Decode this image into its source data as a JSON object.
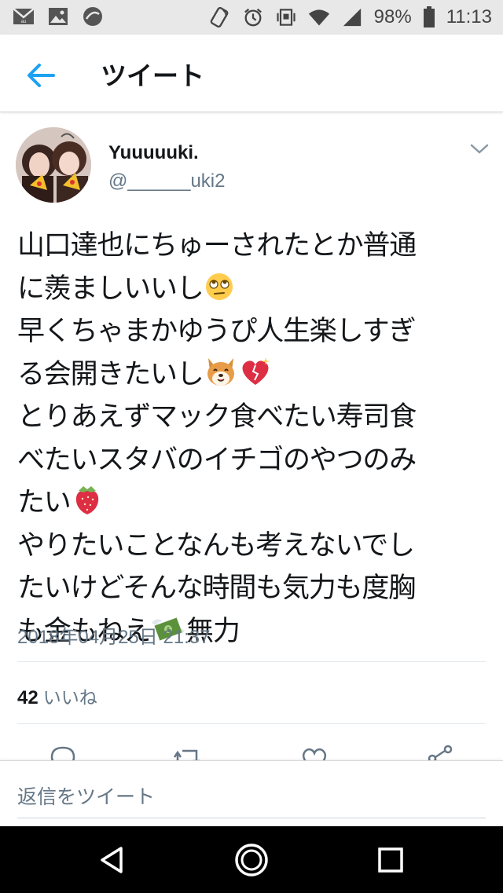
{
  "status_bar": {
    "battery": "98%",
    "time": "11:13",
    "icons": [
      "mail-icon",
      "image-icon",
      "app-icon",
      "nfc-icon",
      "alarm-icon",
      "vibrate-icon",
      "wifi-icon",
      "signal-icon",
      "battery-icon"
    ]
  },
  "app_bar": {
    "title": "ツイート",
    "back_icon": "back-arrow-icon"
  },
  "tweet": {
    "display_name": "Yuuuuuki.",
    "handle": "@______uki2",
    "lines": [
      "山口達也にちゅーされたとか普通",
      "に羨ましいいし",
      "早くちゃまかゆうぴ人生楽しすぎ",
      "る会開きたいし",
      "とりあえずマック食べたい寿司食",
      "べたいスタバのイチゴのやつのみ",
      "たい",
      "やりたいことなんも考えないでし",
      "たいけどそんな時間も気力も度胸",
      "も金もねえ",
      "無力"
    ],
    "emojis": [
      "eye-roll-emoji",
      "shiba-dog-emoji",
      "sparkling-heart-emoji",
      "strawberry-emoji",
      "money-with-wings-emoji"
    ],
    "timestamp": "2018年04月25日 21:37",
    "likes_count": "42",
    "likes_label": "いいね"
  },
  "actions": [
    "reply-icon",
    "retweet-icon",
    "like-icon",
    "share-icon"
  ],
  "reply": {
    "placeholder": "返信をツイート"
  },
  "colors": {
    "accent": "#1da1f2",
    "secondary_text": "#657786",
    "divider": "#e1e8ed"
  }
}
